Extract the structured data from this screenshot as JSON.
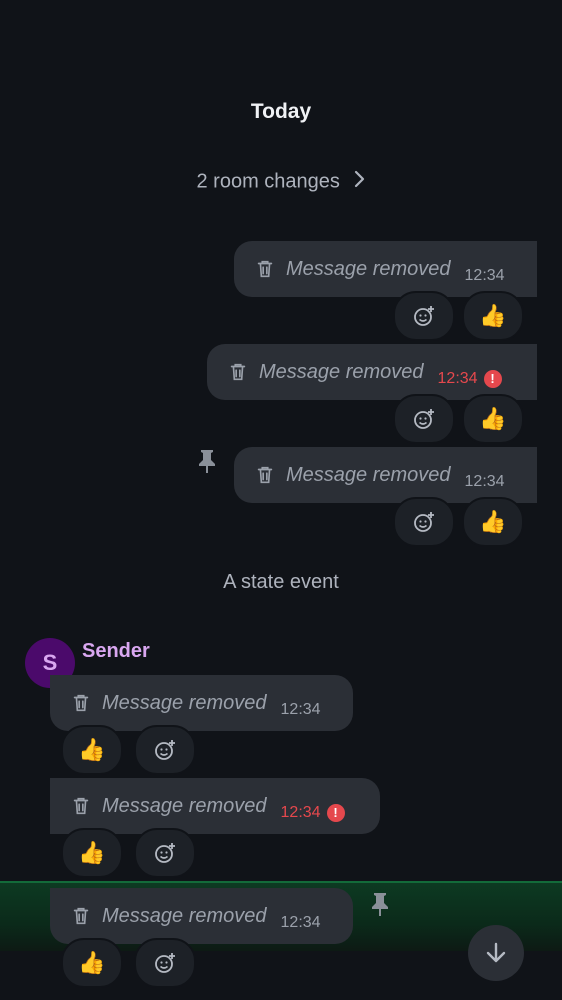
{
  "timeline": {
    "day_divider": "Today",
    "room_changes": "2 room changes",
    "state_event": "A state event"
  },
  "sender": {
    "name": "Sender",
    "avatar_initial": "S"
  },
  "messages": [
    {
      "text": "Message removed",
      "time": "12:34",
      "reaction": "👍"
    },
    {
      "text": "Message removed",
      "time": "12:34",
      "reaction": "👍",
      "error": "!"
    },
    {
      "text": "Message removed",
      "time": "12:34",
      "reaction": "👍"
    },
    {
      "text": "Message removed",
      "time": "12:34",
      "reaction": "👍"
    },
    {
      "text": "Message removed",
      "time": "12:34",
      "reaction": "👍",
      "error": "!"
    },
    {
      "text": "Message removed",
      "time": "12:34",
      "reaction": "👍"
    }
  ],
  "colors": {
    "background": "#101318",
    "bubble": "#2b2f36",
    "error": "#e5484d",
    "sender": "#d9a7f0",
    "highlight": "#0d3a22"
  },
  "icons": [
    "trash-icon",
    "add-reaction-icon",
    "pin-icon",
    "chevron-right-icon",
    "arrow-down-icon",
    "error-icon"
  ]
}
